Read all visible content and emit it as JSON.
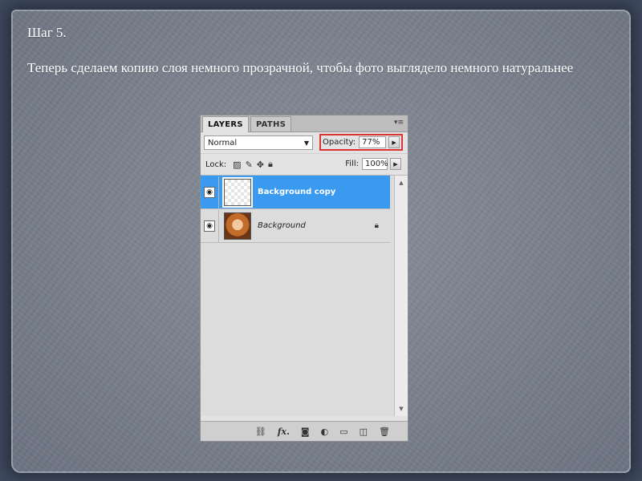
{
  "slide": {
    "step_title": "Шаг 5.",
    "description": "Теперь сделаем копию слоя немного прозрачной, чтобы фото выглядело немного натуральнее"
  },
  "panel": {
    "tabs": [
      {
        "label": "LAYERS",
        "active": true
      },
      {
        "label": "PATHS",
        "active": false
      }
    ],
    "menu_icon": "▾≡",
    "blend_mode": "Normal",
    "opacity_label": "Opacity:",
    "opacity_value": "77%",
    "lock_label": "Lock:",
    "fill_label": "Fill:",
    "fill_value": "100%",
    "layers": [
      {
        "name": "Background copy",
        "selected": true,
        "visible": true,
        "locked": false
      },
      {
        "name": "Background",
        "selected": false,
        "visible": true,
        "locked": true
      }
    ],
    "highlight_color": "#d93535",
    "selection_color": "#3a9af0"
  }
}
